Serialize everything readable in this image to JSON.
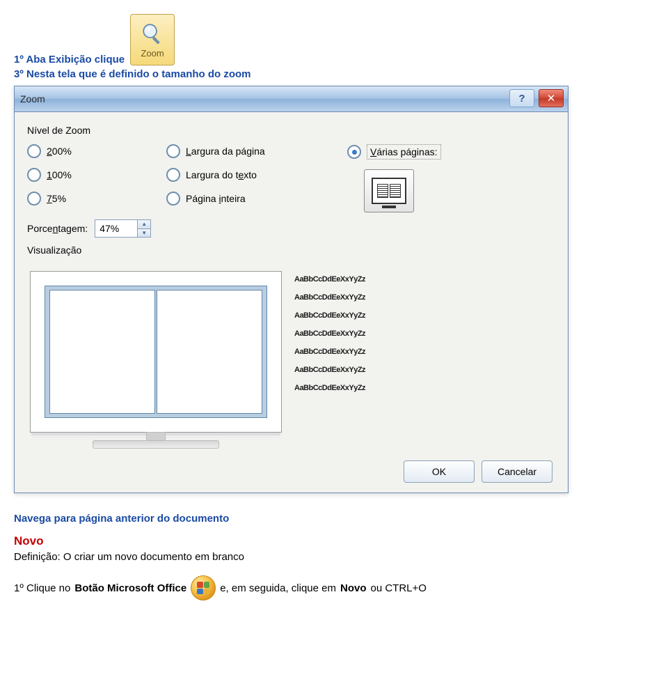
{
  "intro": {
    "line1": "1º Aba Exibição clique",
    "line2": "3º Nesta tela que é definido o tamanho do zoom",
    "zoom_btn_label": "Zoom"
  },
  "dialog": {
    "title": "Zoom",
    "help": "?",
    "close": "✕",
    "section_nivel": "Nível de Zoom",
    "radios": {
      "r200": "200%",
      "r100": "100%",
      "r75": "75%",
      "r_largura_pagina": "Largura da página",
      "r_largura_texto": "Largura do texto",
      "r_pagina_inteira": "Página inteira",
      "r_varias_paginas": "Várias páginas:"
    },
    "pct_label": "Porcentagem:",
    "pct_value": "47%",
    "section_visualizacao": "Visualização",
    "sample_text": "AaBbCcDdEeXxYyZz",
    "ok": "OK",
    "cancel": "Cancelar"
  },
  "below": {
    "navega": "Navega para página anterior do documento",
    "novo_title": "Novo",
    "novo_def": "Definição: O criar um novo documento em branco",
    "final_1": "1º Clique no ",
    "final_bold": "Botão Microsoft Office",
    "final_2": " e, em seguida, clique em ",
    "final_bold2": "Novo",
    "final_3": " ou CTRL+O"
  }
}
